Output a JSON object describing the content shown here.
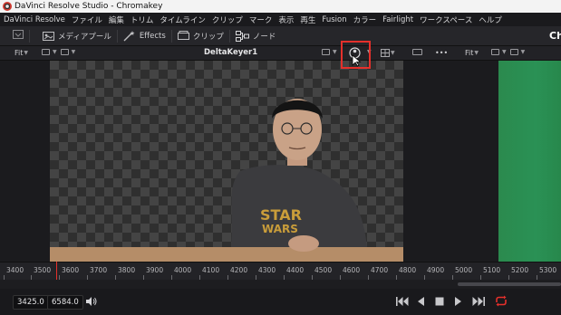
{
  "window": {
    "title": "DaVinci Resolve Studio - Chromakey"
  },
  "menu": [
    "DaVinci Resolve",
    "ファイル",
    "編集",
    "トリム",
    "タイムライン",
    "クリップ",
    "マーク",
    "表示",
    "再生",
    "Fusion",
    "カラー",
    "Fairlight",
    "ワークスペース",
    "ヘルプ"
  ],
  "toolbar": {
    "media_pool": "メディアプール",
    "effects": "Effects",
    "clips": "クリップ",
    "nodes": "ノード",
    "right_tab": "Ch"
  },
  "viewer": {
    "fit_left": "Fit",
    "fit_right": "Fit",
    "title": "DeltaKeyer1",
    "dots": "•••"
  },
  "ruler": {
    "labels": [
      "3400",
      "3500",
      "3600",
      "3700",
      "3800",
      "3900",
      "4000",
      "4100",
      "4200",
      "4300",
      "4400",
      "4500",
      "4600",
      "4700",
      "4800",
      "4900",
      "5000",
      "5100",
      "5200",
      "5300"
    ]
  },
  "transport": {
    "timecode_in": "3425.0",
    "timecode_out": "6584.0"
  },
  "colors": {
    "highlight": "#e5302b",
    "loop": "#e5302b",
    "greenscreen": "#2a9155"
  }
}
